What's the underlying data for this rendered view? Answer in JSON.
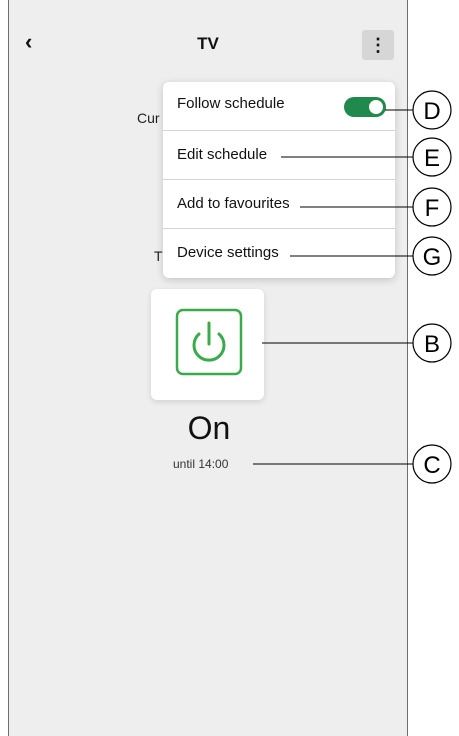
{
  "header": {
    "back_icon": "chevron-left-icon",
    "title": "TV",
    "more_icon": "more-vertical-icon"
  },
  "background_text": {
    "partial_line_1": "Cur",
    "partial_line_2": "T"
  },
  "menu": {
    "items": [
      {
        "label": "Follow schedule",
        "toggle_on": true
      },
      {
        "label": "Edit schedule"
      },
      {
        "label": "Add to favourites"
      },
      {
        "label": "Device settings"
      }
    ],
    "toggle_color": "#1f8a4c"
  },
  "device": {
    "power_icon": "power-icon",
    "power_color": "#3aaa4a",
    "state": "On",
    "until": "until 14:00"
  },
  "callouts": [
    "D",
    "E",
    "F",
    "G",
    "B",
    "C"
  ]
}
